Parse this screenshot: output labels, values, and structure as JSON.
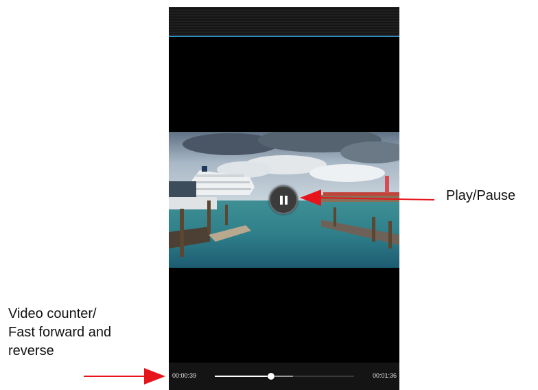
{
  "player": {
    "current_time": "00:00:39",
    "total_time": "00:01:36",
    "progress": 0.406,
    "buffered": 0.56,
    "state": "playing",
    "pause_icon": "pause-icon"
  },
  "annotations": {
    "play_pause": "Play/Pause",
    "video_counter_lines": [
      "Video counter/",
      "Fast forward and",
      "reverse"
    ]
  },
  "colors": {
    "arrow": "#e8141b",
    "accent_line": "#2f8ec4",
    "background": "#000000"
  }
}
